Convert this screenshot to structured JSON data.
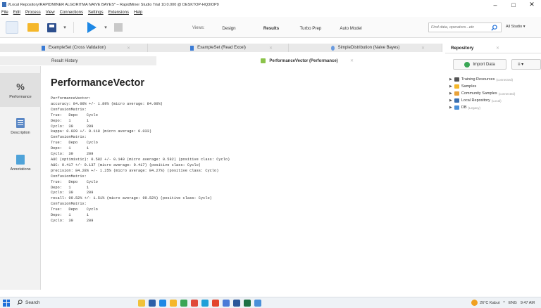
{
  "window": {
    "title": "//Local Repository/RAPIDMINER ALGORITMA NAIVE BAYES* – RapidMiner Studio Trial 10.0.000 @ DESKTOP-HQ3IOP9",
    "controls": [
      "–",
      "□",
      "✕"
    ]
  },
  "menu": [
    "File",
    "Edit",
    "Process",
    "View",
    "Connections",
    "Settings",
    "Extensions",
    "Help"
  ],
  "toolbar": {
    "views_label": "Views:",
    "views": [
      "Design",
      "Results",
      "Turbo Prep",
      "Auto Model"
    ],
    "active_view": "Results",
    "search_placeholder": "Find data, operators...etc",
    "studio_label": "All Studio ▾"
  },
  "doc_tabs": [
    {
      "label": "ExampleSet (Cross Validation)",
      "color": "#3a7bd5"
    },
    {
      "label": "ExampleSet (Read Excel)",
      "color": "#3a7bd5"
    },
    {
      "label": "SimpleDistribution (Naive Bayes)",
      "color": "#6a9be0"
    }
  ],
  "sub_tabs": {
    "result_history": "Result History",
    "performance": "PerformanceVector (Performance)"
  },
  "side_nav": [
    {
      "label": "Performance",
      "icon": "percent-icon"
    },
    {
      "label": "Description",
      "icon": "document-icon"
    },
    {
      "label": "Annotations",
      "icon": "annotation-icon"
    }
  ],
  "main": {
    "title": "PerformanceVector",
    "lines": [
      "PerformanceVector:",
      "accuracy: 84.00% +/- 1.89% (micro average: 84.00%)",
      "ConfusionMatrix:",
      "True:   Depo    Cyclo",
      "Depo:   1       1",
      "Cyclo:  39      209",
      "kappa: 0.029 +/- 0.118 (micro average: 0.033)",
      "ConfusionMatrix:",
      "True:   Depo    Cyclo",
      "Depo:   1       1",
      "Cyclo:  39      209",
      "AUC (optimistic): 0.582 +/- 0.140 (micro average: 0.582) (positive class: Cyclo)",
      "AUC: 0.417 +/- 0.137 (micro average: 0.417) (positive class: Cyclo)",
      "precision: 84.28% +/- 1.25% (micro average: 84.27%) (positive class: Cyclo)",
      "ConfusionMatrix:",
      "True:   Depo    Cyclo",
      "Depo:   1       1",
      "Cyclo:  39      209",
      "recall: 99.52% +/- 1.51% (micro average: 99.52%) (positive class: Cyclo)",
      "ConfusionMatrix:",
      "True:   Depo    Cyclo",
      "Depo:   1       1",
      "Cyclo:  39      209"
    ]
  },
  "repository": {
    "tab": "Repository",
    "import_button": "Import Data",
    "menu_button": "≡ ▾",
    "nodes": [
      {
        "label": "Training Resources",
        "tag": "(connected)",
        "color": "#555555"
      },
      {
        "label": "Samples",
        "tag": "",
        "color": "#f5b72a"
      },
      {
        "label": "Community Samples",
        "tag": "(connected)",
        "color": "#e8a23a"
      },
      {
        "label": "Local Repository",
        "tag": "(Local)",
        "color": "#3a6fb0"
      },
      {
        "label": "DB",
        "tag": "(Legacy)",
        "color": "#4a90d9"
      }
    ]
  },
  "taskbar": {
    "search": "Search",
    "weather": "26°C  Kabut",
    "lang": "ENG",
    "time": "9:47 AM"
  }
}
